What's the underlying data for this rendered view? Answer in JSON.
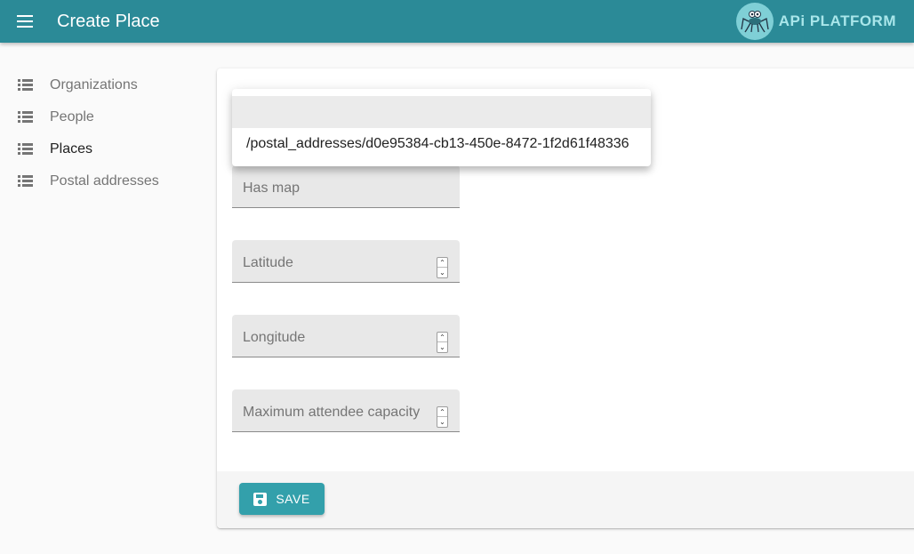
{
  "appbar": {
    "title": "Create Place",
    "logo_text": "APi PLATFORM"
  },
  "sidebar": {
    "items": [
      {
        "label": "Organizations",
        "icon": "list-icon",
        "active": false
      },
      {
        "label": "People",
        "icon": "list-icon",
        "active": false
      },
      {
        "label": "Places",
        "icon": "list-icon",
        "active": true
      },
      {
        "label": "Postal addresses",
        "icon": "list-icon",
        "active": false
      }
    ]
  },
  "form": {
    "dropdown": {
      "options": [
        "",
        "/postal_addresses/d0e95384-cb13-450e-8472-1f2d61f48336"
      ]
    },
    "fields": [
      {
        "label": "Has map",
        "value": ""
      },
      {
        "label": "Latitude",
        "value": ""
      },
      {
        "label": "Longitude",
        "value": ""
      },
      {
        "label": "Maximum attendee capacity",
        "value": ""
      }
    ]
  },
  "toolbar": {
    "save_label": "SAVE"
  },
  "colors": {
    "primary": "#2b8a97",
    "button": "#33a0ab",
    "background": "#fafafa"
  }
}
